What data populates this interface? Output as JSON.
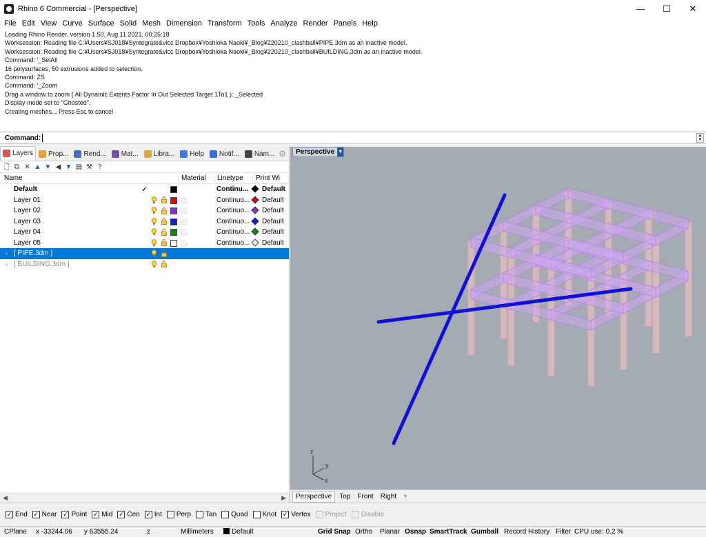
{
  "window": {
    "title": "Rhino 6 Commercial - [Perspective]",
    "minimize": "—",
    "maximize": "☐",
    "close": "✕"
  },
  "menu": [
    "File",
    "Edit",
    "View",
    "Curve",
    "Surface",
    "Solid",
    "Mesh",
    "Dimension",
    "Transform",
    "Tools",
    "Analyze",
    "Render",
    "Panels",
    "Help"
  ],
  "command_history": [
    "Loading Rhino Render, version 1.50, Aug 11 2021, 00:25:18",
    "Worksession: Reading file C:¥Users¥SJ018¥Syntegrate&vicc Dropbox¥Yoshioka Naoki¥_Blog¥220210_clashball¥PIPE.3dm as an inactive model.",
    "Worksession: Reading file C:¥Users¥SJ018¥Syntegrate&vicc Dropbox¥Yoshioka Naoki¥_Blog¥220210_clashball¥BUILDING.3dm as an inactive model.",
    "Command: '_SelAll",
    "16 polysurfaces, 50 extrusions added to selection.",
    "Command: ZS",
    "Command: '_Zoom",
    "Drag a window to zoom ( All  Dynamic  Extents  Factor  In  Out  Selected  Target  1To1 ): _Selected",
    "Display mode set to \"Ghosted\".",
    "Creating meshes... Press Esc to cancel"
  ],
  "command_prompt": "Command:",
  "panel_tabs": [
    {
      "label": "Layers",
      "color": "#d9534f"
    },
    {
      "label": "Prop...",
      "color": "#e8a23a"
    },
    {
      "label": "Rend...",
      "color": "#4a6fb5"
    },
    {
      "label": "Mat...",
      "color": "#7a4fa0"
    },
    {
      "label": "Libra...",
      "color": "#d4a94a"
    },
    {
      "label": "Help",
      "color": "#3b7dd8"
    },
    {
      "label": "Notif...",
      "color": "#3b6fd8"
    },
    {
      "label": "Nam...",
      "color": "#444444"
    }
  ],
  "layer_columns": {
    "name": "Name",
    "material": "Material",
    "linetype": "Linetype",
    "printwidth": "Print Wi"
  },
  "layers": [
    {
      "name": "Default",
      "current": "✓",
      "color": "#000000",
      "linetype": "Continu...",
      "print_color": "#000000",
      "print_width": "Default",
      "bold": true
    },
    {
      "name": "Layer 01",
      "color": "#cc1111",
      "linetype": "Continuo...",
      "print_color": "#cc1111",
      "print_width": "Default"
    },
    {
      "name": "Layer 02",
      "color": "#8b2fc9",
      "linetype": "Continuo...",
      "print_color": "#8b2fc9",
      "print_width": "Default"
    },
    {
      "name": "Layer 03",
      "color": "#1a1ad6",
      "linetype": "Continuo...",
      "print_color": "#1a1ad6",
      "print_width": "Default"
    },
    {
      "name": "Layer 04",
      "color": "#118811",
      "linetype": "Continuo...",
      "print_color": "#118811",
      "print_width": "Default"
    },
    {
      "name": "Layer 05",
      "color": "#ffffff",
      "linetype": "Continuo...",
      "print_color": "#ffffff",
      "print_width": "Default"
    }
  ],
  "worksession_models": [
    {
      "name": "[ PIPE.3dm ]",
      "selected": true
    },
    {
      "name": "[ BUILDING.3dm ]",
      "selected": false
    }
  ],
  "viewport": {
    "name": "Perspective",
    "axes": {
      "x": "x",
      "y": "y",
      "z": "z"
    }
  },
  "viewport_tabs": [
    "Perspective",
    "Top",
    "Front",
    "Right",
    "+"
  ],
  "osnaps": [
    {
      "label": "End",
      "checked": true
    },
    {
      "label": "Near",
      "checked": true
    },
    {
      "label": "Point",
      "checked": true
    },
    {
      "label": "Mid",
      "checked": true
    },
    {
      "label": "Cen",
      "checked": true
    },
    {
      "label": "Int",
      "checked": true
    },
    {
      "label": "Perp",
      "checked": false
    },
    {
      "label": "Tan",
      "checked": false
    },
    {
      "label": "Quad",
      "checked": false
    },
    {
      "label": "Knot",
      "checked": false
    },
    {
      "label": "Vertex",
      "checked": true
    },
    {
      "label": "Project",
      "checked": false,
      "disabled": true
    },
    {
      "label": "Disable",
      "checked": false,
      "disabled": true
    }
  ],
  "status": {
    "cplane": "CPlane",
    "x": "x -33244.06",
    "y": "y 63555.24",
    "z": "z",
    "units": "Millimeters",
    "layer": "Default",
    "grid_snap": "Grid Snap",
    "ortho": "Ortho",
    "planar": "Planar",
    "osnap": "Osnap",
    "smarttrack": "SmartTrack",
    "gumball": "Gumball",
    "record_history": "Record History",
    "filter": "Filter",
    "cpu": "CPU use: 0.2 %"
  }
}
